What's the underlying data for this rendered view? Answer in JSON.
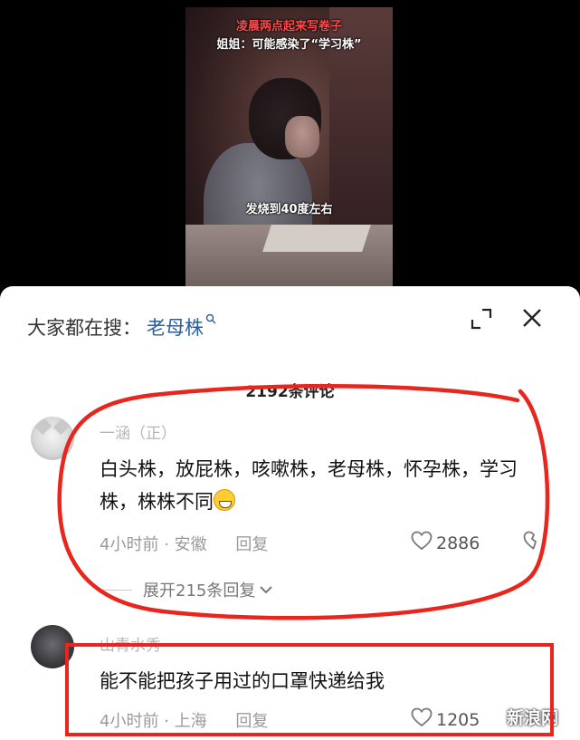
{
  "video": {
    "caption_line1": "凌晨两点起来写卷子",
    "caption_line2": "姐姐：可能感染了“学习株”",
    "caption_mid": "发烧到40度左右"
  },
  "search": {
    "prefix": "大家都在搜：",
    "keyword": "老母株"
  },
  "comments_count": "2192条评论",
  "comments": [
    {
      "username": "一涵（正）",
      "text": "白头株，放屁株，咳嗽株，老母株，怀孕株，学习株，株株不同",
      "emoji": "grinning-face-emoji",
      "time": "4小时前",
      "location": "安徽",
      "reply_label": "回复",
      "likes": "2886",
      "expand_label": "展开215条回复"
    },
    {
      "username": "山青水秀",
      "text": "能不能把孩子用过的口罩快递给我",
      "time": "4小时前",
      "location": "上海",
      "reply_label": "回复",
      "likes": "1205"
    }
  ],
  "watermark": "新浪网",
  "colors": {
    "annotation_red": "#e8261e",
    "keyword_blue": "#2a5d9c"
  },
  "icons": [
    "search-icon",
    "expand-icon",
    "close-icon",
    "heart-icon",
    "dislike-icon",
    "chevron-down-icon"
  ]
}
